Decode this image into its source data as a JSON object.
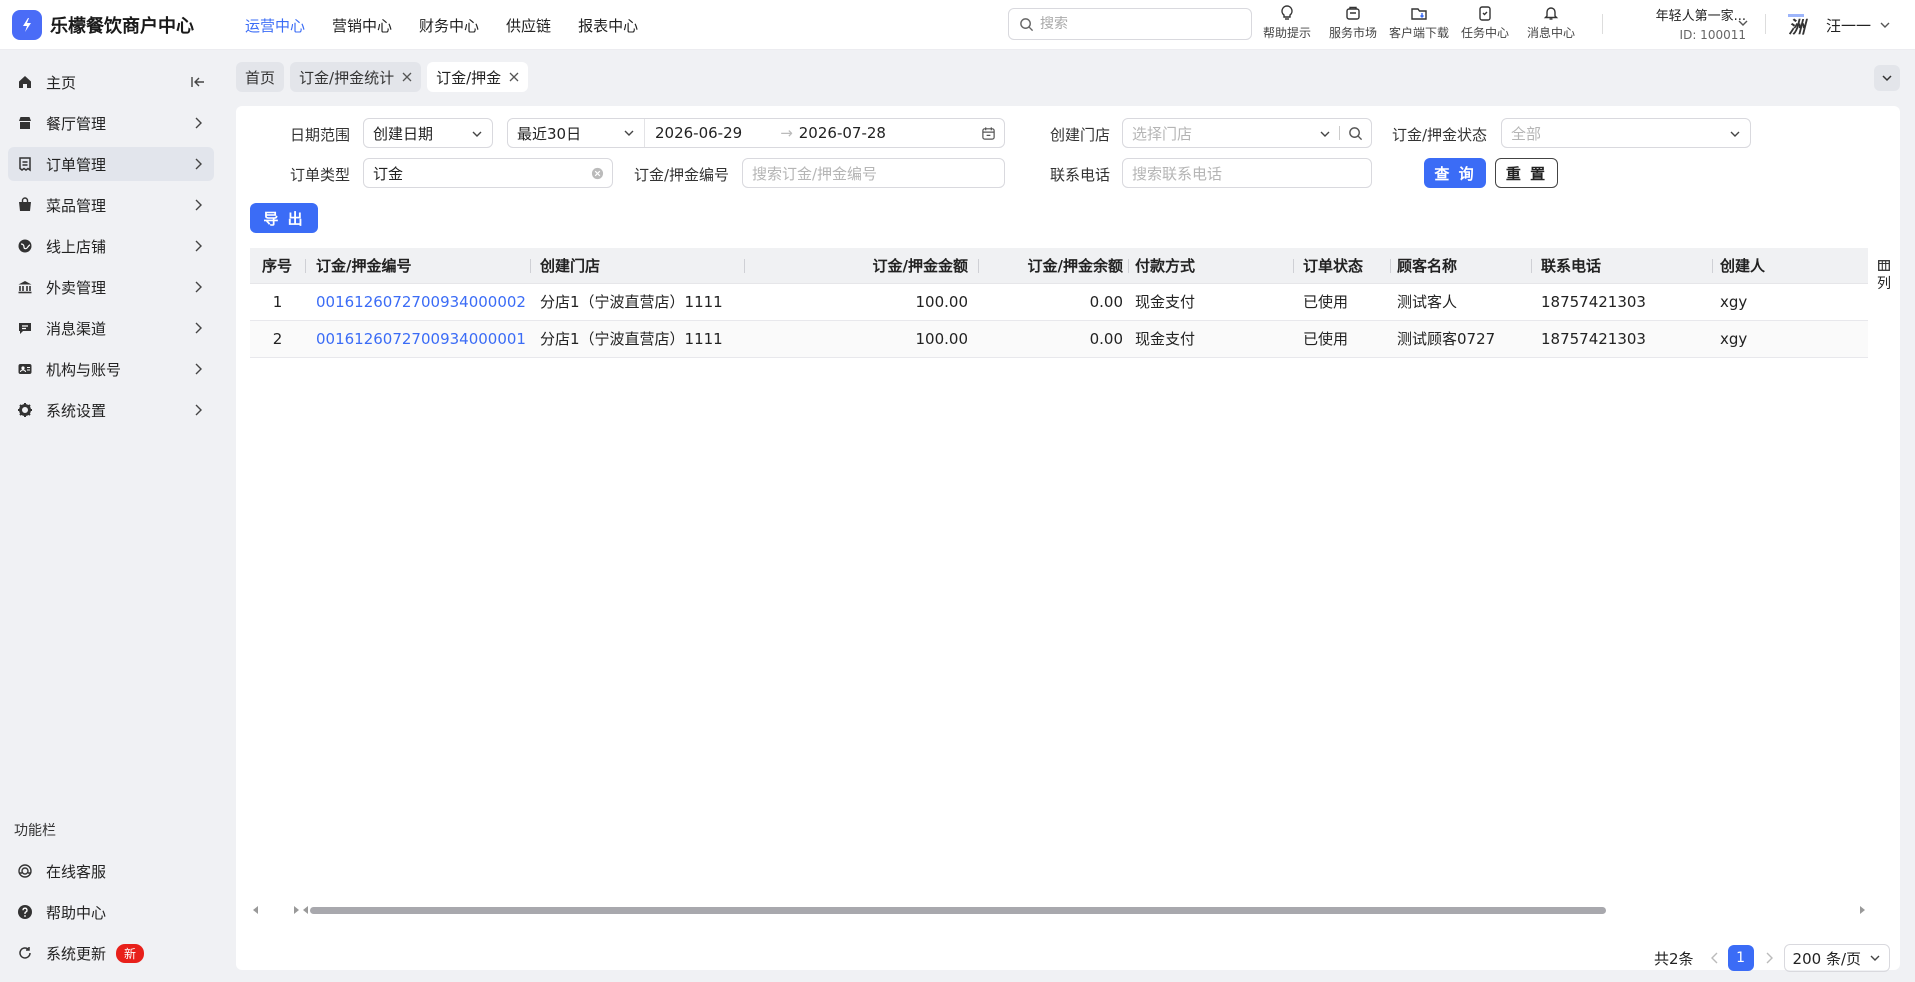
{
  "app": {
    "title": "乐檬餐饮商户中心"
  },
  "topnav": [
    "运营中心",
    "营销中心",
    "财务中心",
    "供应链",
    "报表中心"
  ],
  "search": {
    "placeholder": "搜索"
  },
  "tools": [
    "帮助提示",
    "服务市场",
    "客户端下载",
    "任务中心",
    "消息中心"
  ],
  "account": {
    "name": "年轻人第一家...",
    "id": "ID: 100011"
  },
  "user": {
    "avatar_text": "洲",
    "name": "汪一一"
  },
  "sidebar": {
    "items": [
      "主页",
      "餐厅管理",
      "订单管理",
      "菜品管理",
      "线上店铺",
      "外卖管理",
      "消息渠道",
      "机构与账号",
      "系统设置"
    ],
    "section_title": "功能栏",
    "func_items": [
      "在线客服",
      "帮助中心",
      "系统更新"
    ],
    "new_badge": "新"
  },
  "tabs": [
    "首页",
    "订金/押金统计",
    "订金/押金"
  ],
  "filters": {
    "date_range_label": "日期范围",
    "date_type": "创建日期",
    "date_preset": "最近30日",
    "start_date": "2026-06-29",
    "end_date": "2026-07-28",
    "store_label": "创建门店",
    "store_placeholder": "选择门店",
    "status_label": "订金/押金状态",
    "status_placeholder": "全部",
    "order_type_label": "订单类型",
    "order_type_value": "订金",
    "number_label": "订金/押金编号",
    "number_placeholder": "搜索订金/押金编号",
    "phone_label": "联系电话",
    "phone_placeholder": "搜索联系电话",
    "query_button": "查 询",
    "reset_button": "重 置",
    "export_button": "导 出"
  },
  "table": {
    "columns": [
      "序号",
      "订金/押金编号",
      "创建门店",
      "订金/押金金额",
      "订金/押金余额",
      "付款方式",
      "订单状态",
      "顾客名称",
      "联系电话",
      "创建人"
    ],
    "rows": [
      [
        "1",
        "0016126072700934000002",
        "分店1（宁波直营店）1111",
        "100.00",
        "0.00",
        "现金支付",
        "已使用",
        "测试客人",
        "18757421303",
        "xgy"
      ],
      [
        "2",
        "0016126072700934000001",
        "分店1（宁波直营店）1111",
        "100.00",
        "0.00",
        "现金支付",
        "已使用",
        "测试顾客0727",
        "18757421303",
        "xgy"
      ]
    ],
    "column_setting_label": "列"
  },
  "pagination": {
    "total": "共2条",
    "current_page": "1",
    "page_size": "200 条/页"
  },
  "colors": {
    "accent": "#3b6cf6",
    "badge": "#e8201a"
  }
}
